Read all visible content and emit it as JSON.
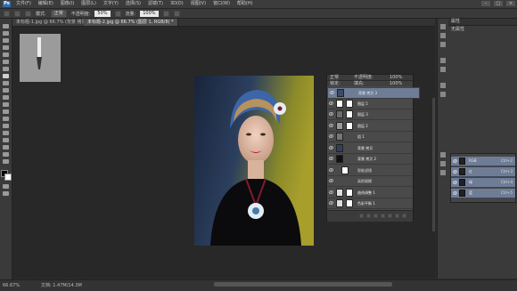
{
  "app": {
    "logo": "Ps"
  },
  "menubar": {
    "items": [
      "文件(F)",
      "编辑(E)",
      "图像(I)",
      "图层(L)",
      "文字(Y)",
      "选择(S)",
      "滤镜(T)",
      "3D(D)",
      "视图(V)",
      "窗口(W)",
      "帮助(H)"
    ],
    "window_controls": [
      "–",
      "□",
      "×"
    ]
  },
  "optbar": {
    "mode_label": "模式:",
    "mode_value": "正常",
    "opacity_label": "不透明度:",
    "opacity_value": "50%",
    "flow_label": "流量:",
    "flow_value": "100%"
  },
  "tabs": [
    {
      "label": "未标题-1.jpg @ 66.7% (背景 拷贝, RGB/8) *",
      "active": false
    },
    {
      "label": "未标题-2.jpg @ 66.7% (图层 1, RGB/8) *",
      "active": true
    }
  ],
  "layers": {
    "blend": "正常",
    "opacity_label": "不透明度:",
    "opacity": "100%",
    "fill_label": "填充:",
    "fill": "100%",
    "lock_label": "锁定:",
    "rows": [
      {
        "name": "背景 拷贝 3",
        "selected": true,
        "thumb": "#3b4b6a"
      },
      {
        "name": "图层 5",
        "selected": false,
        "thumb": "#ffffff"
      },
      {
        "name": "图层 3",
        "selected": false,
        "thumb": "#6c6c6c"
      },
      {
        "name": "图层 2",
        "selected": false,
        "thumb": "#9a9a9a"
      },
      {
        "name": "组 1",
        "selected": false,
        "thumb": "#777777"
      },
      {
        "name": "背景 拷贝",
        "selected": false,
        "thumb": "#2f3f5e"
      },
      {
        "name": "背景 拷贝 2",
        "selected": false,
        "thumb": "#111111"
      },
      {
        "name": "智能滤镜",
        "selected": false,
        "thumb": "#ffffff"
      },
      {
        "name": "高斯模糊",
        "selected": false,
        "thumb": ""
      },
      {
        "name": "曲线调整 1",
        "selected": false,
        "thumb": "#dddddd"
      },
      {
        "name": "色彩平衡 1",
        "selected": false,
        "thumb": "#dddddd"
      }
    ]
  },
  "rpanel": {
    "title": "属性",
    "subtitle": "无属性"
  },
  "channels": {
    "rows": [
      {
        "name": "RGB",
        "shortcut": "Ctrl+2"
      },
      {
        "name": "红",
        "shortcut": "Ctrl+3"
      },
      {
        "name": "绿",
        "shortcut": "Ctrl+4"
      },
      {
        "name": "蓝",
        "shortcut": "Ctrl+5"
      }
    ]
  },
  "status": {
    "zoom": "66.67%",
    "doc": "文档: 1.47M/14.3M"
  },
  "colors": {
    "selection": "#6f7c96",
    "canvas": "#282828",
    "panel": "#3a3a3a"
  }
}
